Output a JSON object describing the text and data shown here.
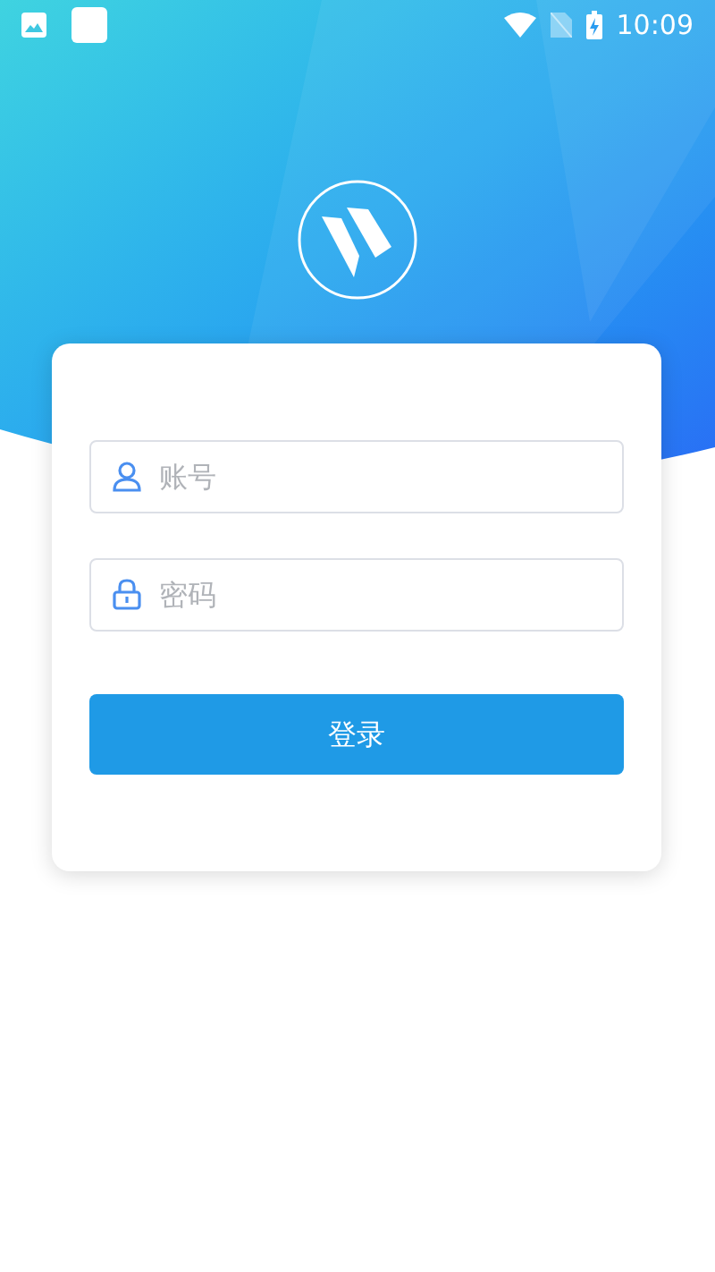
{
  "status_bar": {
    "time": "10:09"
  },
  "form": {
    "username": {
      "placeholder": "账号"
    },
    "password": {
      "placeholder": "密码"
    },
    "login_button": "登录"
  }
}
